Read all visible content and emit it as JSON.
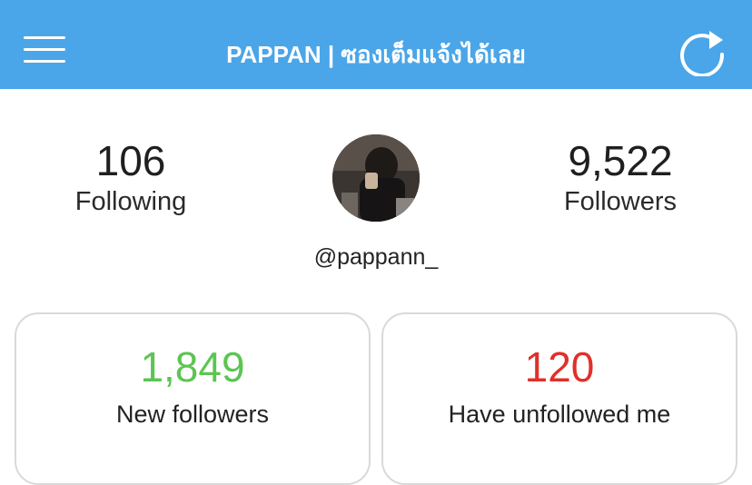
{
  "header": {
    "title": "PAPPAN | ซองเต็มแจ้งได้เลย",
    "menu_icon": "hamburger-menu-icon",
    "refresh_icon": "refresh-icon",
    "background_color": "#4aa6e8"
  },
  "profile": {
    "following_count": "106",
    "following_label": "Following",
    "followers_count": "9,522",
    "followers_label": "Followers",
    "username": "@pappann_"
  },
  "cards": {
    "new_followers_count": "1,849",
    "new_followers_label": "New followers",
    "new_followers_color": "#5cc552",
    "unfollowed_count": "120",
    "unfollowed_label": "Have unfollowed me",
    "unfollowed_color": "#e0302a"
  }
}
